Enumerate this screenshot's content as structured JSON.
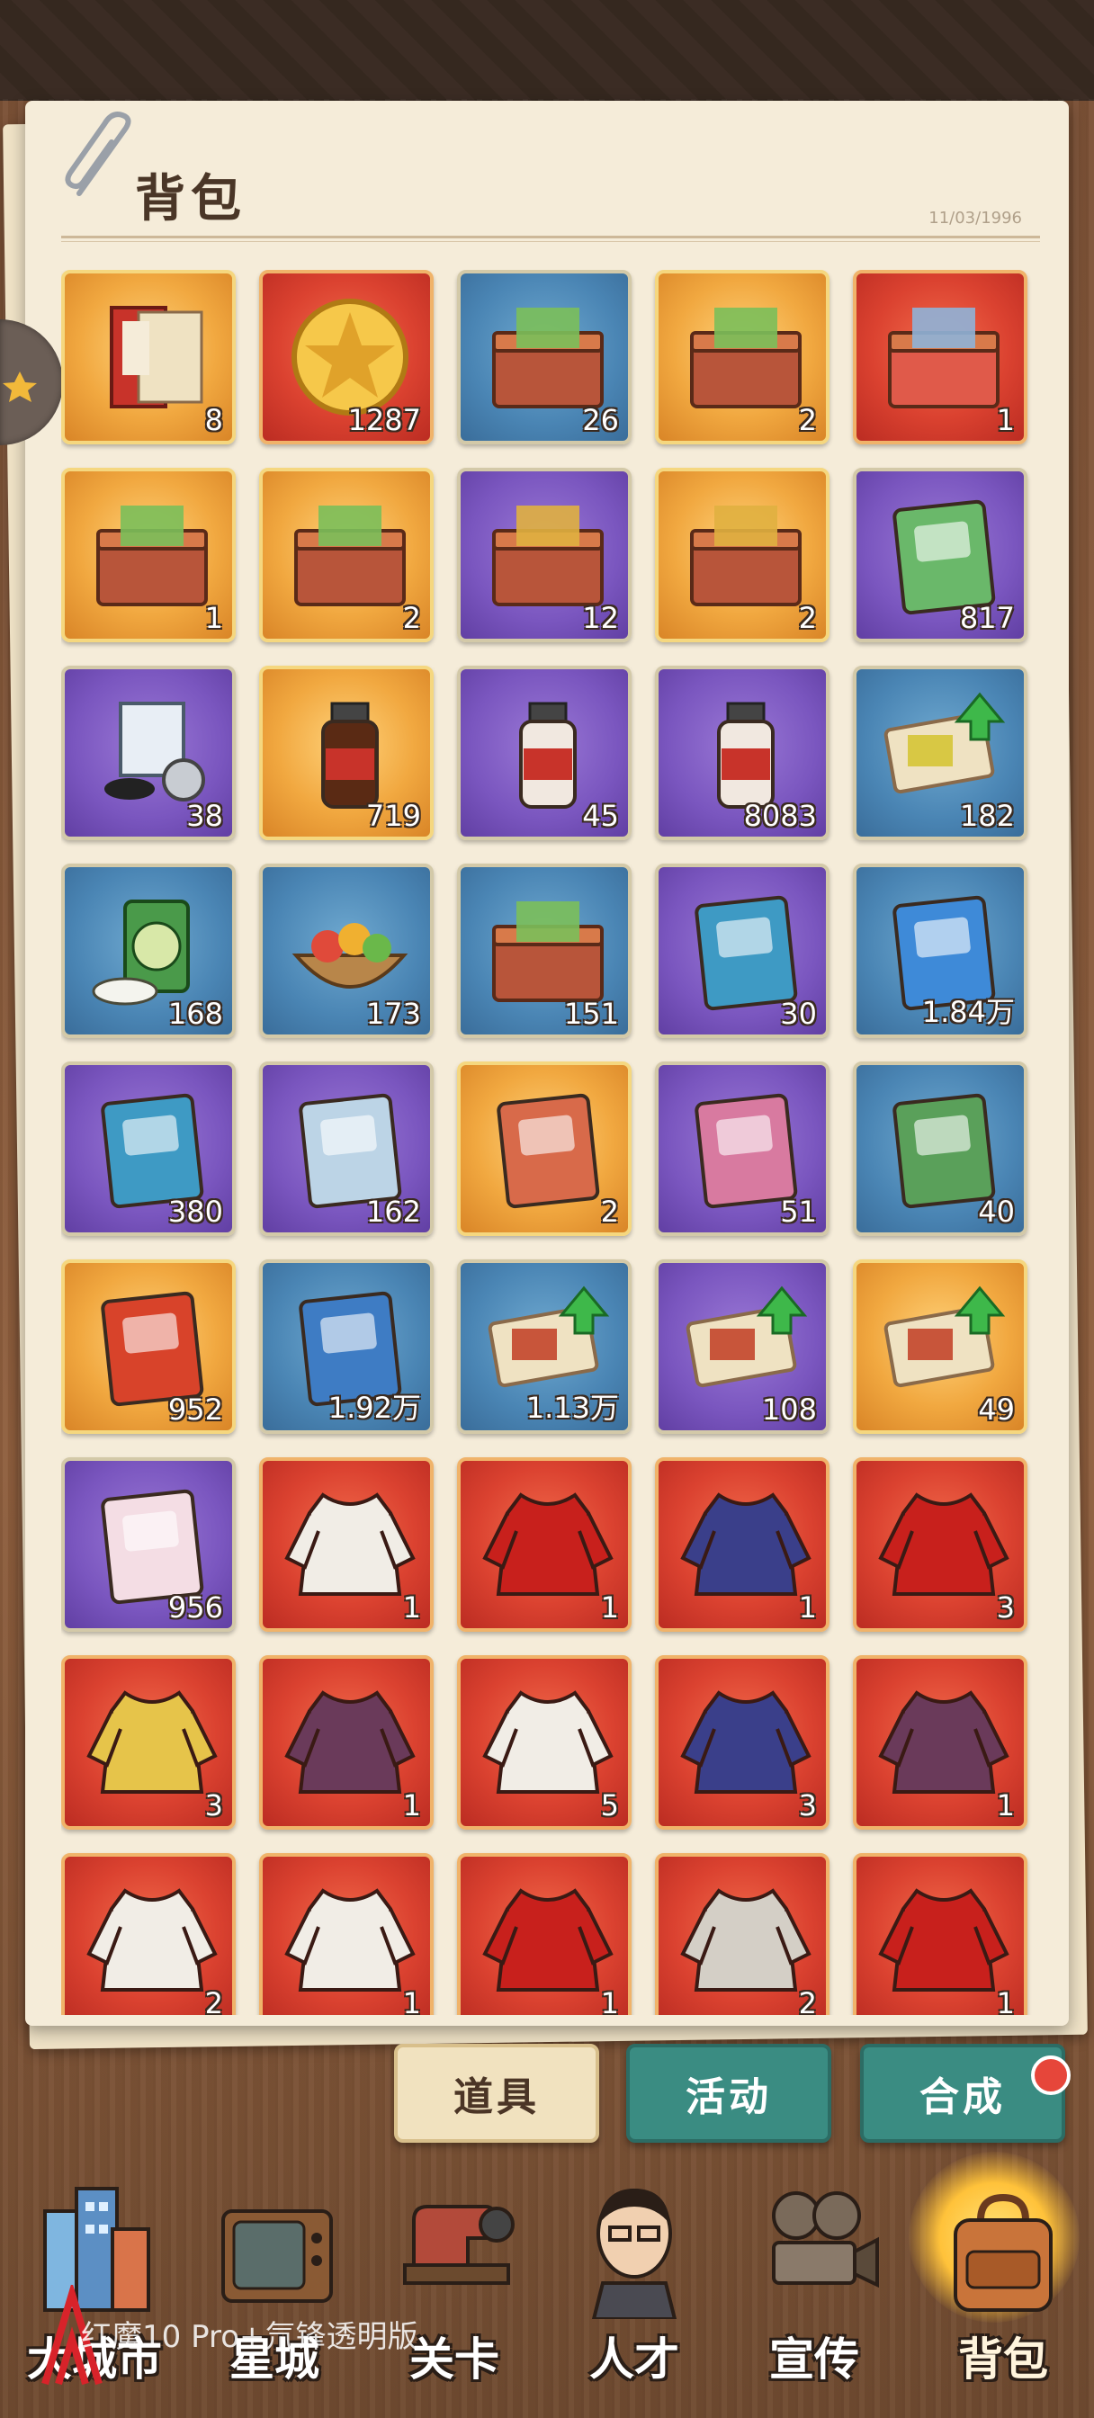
{
  "header": {
    "title": "背包",
    "date": "11/03/1996"
  },
  "grid": [
    {
      "bg": "gold",
      "icon": "banquet-invitation-icon",
      "count": "8"
    },
    {
      "bg": "red",
      "icon": "gold-star-coin-icon",
      "count": "1287"
    },
    {
      "bg": "blue",
      "icon": "snack-gift-box-icon",
      "count": "26"
    },
    {
      "bg": "gold",
      "icon": "car-gift-box-icon",
      "count": "2"
    },
    {
      "bg": "red",
      "icon": "villa-gift-box-icon",
      "count": "1"
    },
    {
      "bg": "gold",
      "icon": "heart-gift-box-icon",
      "count": "1"
    },
    {
      "bg": "gold",
      "icon": "treasure-chest-icon",
      "count": "2"
    },
    {
      "bg": "purple",
      "icon": "trophy-box-icon",
      "count": "12"
    },
    {
      "bg": "gold",
      "icon": "trophy-box-icon",
      "count": "2"
    },
    {
      "bg": "purple",
      "icon": "mystery-career-book-icon",
      "count": "817"
    },
    {
      "bg": "purple",
      "icon": "shopping-bag-shoes-watch-icon",
      "count": "38"
    },
    {
      "bg": "gold",
      "icon": "tonic-bottle-icon",
      "count": "719"
    },
    {
      "bg": "purple",
      "icon": "ginseng-drink-icon",
      "count": "45"
    },
    {
      "bg": "purple",
      "icon": "oral-liquid-icon",
      "count": "8083"
    },
    {
      "bg": "blue",
      "icon": "ginkgo-tickets-icon",
      "count": "182"
    },
    {
      "bg": "blue",
      "icon": "tea-can-icon",
      "count": "168"
    },
    {
      "bg": "blue",
      "icon": "fruit-basket-icon",
      "count": "173"
    },
    {
      "bg": "blue",
      "icon": "mooncake-boxes-icon",
      "count": "151"
    },
    {
      "bg": "purple",
      "icon": "id-booklet-icon",
      "count": "30"
    },
    {
      "bg": "blue",
      "icon": "parking-manual-icon",
      "count": "1.84万"
    },
    {
      "bg": "purple",
      "icon": "mystery-book-icon",
      "count": "380"
    },
    {
      "bg": "purple",
      "icon": "certificate-book-icon",
      "count": "162"
    },
    {
      "bg": "gold",
      "icon": "large-economics-book-icon",
      "count": "2"
    },
    {
      "bg": "purple",
      "icon": "medium-economics-book-icon",
      "count": "51"
    },
    {
      "bg": "blue",
      "icon": "small-economics-book-icon",
      "count": "40"
    },
    {
      "bg": "gold",
      "icon": "time-card-icon",
      "count": "952"
    },
    {
      "bg": "blue",
      "icon": "minute-card-icon",
      "count": "1.92万"
    },
    {
      "bg": "blue",
      "icon": "shop-upgrade-ticket-icon",
      "count": "1.13万"
    },
    {
      "bg": "purple",
      "icon": "shop-upgrade-ticket-icon",
      "count": "108"
    },
    {
      "bg": "gold",
      "icon": "shop-upgrade-ticket-icon",
      "count": "49"
    },
    {
      "bg": "purple",
      "icon": "makeup-book-icon",
      "count": "956"
    },
    {
      "bg": "red",
      "icon": "white-dress-icon",
      "count": "1"
    },
    {
      "bg": "red",
      "icon": "red-qipao-icon",
      "count": "1"
    },
    {
      "bg": "red",
      "icon": "blue-suit-icon",
      "count": "1"
    },
    {
      "bg": "red",
      "icon": "red-gown-icon",
      "count": "3"
    },
    {
      "bg": "red",
      "icon": "yellow-camisole-icon",
      "count": "3"
    },
    {
      "bg": "red",
      "icon": "fur-coat-dress-icon",
      "count": "1"
    },
    {
      "bg": "red",
      "icon": "white-lace-dress-icon",
      "count": "5"
    },
    {
      "bg": "red",
      "icon": "office-skirt-suit-icon",
      "count": "3"
    },
    {
      "bg": "red",
      "icon": "fur-shawl-outfit-icon",
      "count": "1"
    },
    {
      "bg": "red",
      "icon": "white-jacket-pink-top-icon",
      "count": "2"
    },
    {
      "bg": "red",
      "icon": "white-hoodie-icon",
      "count": "1"
    },
    {
      "bg": "red",
      "icon": "red-evening-dress-icon",
      "count": "1"
    },
    {
      "bg": "red",
      "icon": "grey-blazer-icon",
      "count": "2"
    },
    {
      "bg": "red",
      "icon": "red-qipao-icon",
      "count": "1"
    }
  ],
  "tabs": [
    {
      "label": "道具",
      "active": true
    },
    {
      "label": "活动",
      "active": false
    },
    {
      "label": "合成",
      "active": false
    }
  ],
  "nav": [
    {
      "label": "大城市",
      "icon": "city-buildings-icon"
    },
    {
      "label": "星城",
      "icon": "tv-icon"
    },
    {
      "label": "关卡",
      "icon": "sewing-machine-icon"
    },
    {
      "label": "人才",
      "icon": "businessman-icon"
    },
    {
      "label": "宣传",
      "icon": "film-camera-icon"
    },
    {
      "label": "背包",
      "icon": "backpack-icon",
      "active": true
    }
  ],
  "watermark": "红魔10 Pro+氘锋透明版",
  "colors": {
    "gold": "#f1a840",
    "red": "#db4230",
    "blue": "#4a85b4",
    "purple": "#7a56bf",
    "tab_active": "#f1e2bf",
    "tab_inactive": "#3a8c82"
  }
}
